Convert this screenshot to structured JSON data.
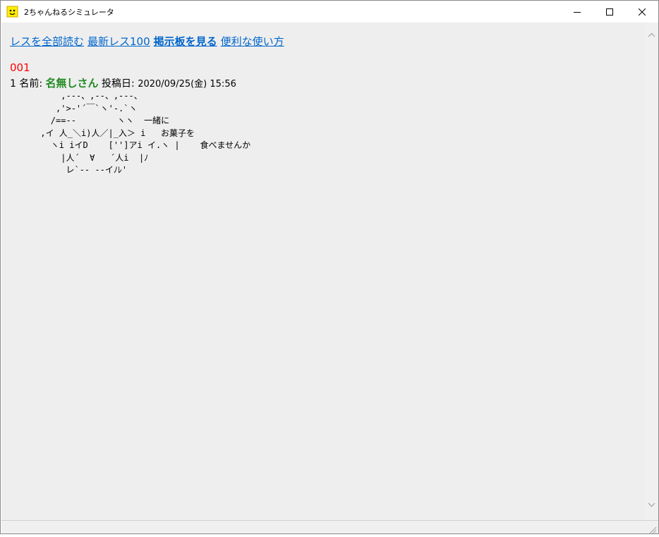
{
  "window": {
    "title": "2ちゃんねるシミュレータ",
    "app_icon": "smiley-face-icon",
    "controls": {
      "minimize": "minimize-icon",
      "maximize": "maximize-icon",
      "close": "close-icon"
    }
  },
  "links": [
    {
      "label": "レスを全部読む",
      "bold": false
    },
    {
      "label": "最新レス100",
      "bold": false
    },
    {
      "label": "掲示板を見る",
      "bold": true
    },
    {
      "label": "便利な使い方",
      "bold": false
    }
  ],
  "post": {
    "res_number": "001",
    "index": "1",
    "name_label": "名前:",
    "name": "名無しさん",
    "date_label": "投稿日:",
    "date": "2020/09/25(金) 15:56",
    "ascii_art": "          ,---、,--、,---、\n         ,'>-'´￣`ヽ'-.`ヽ\n        /==--        ヽヽ  一緒に\n      ,イ 人_＼i)人／|_入＞ i   お菓子を\n        ヽi iイD    ['']アi イ.ヽ |    食べませんか\n          |人´  ∀   ´人i  |ﾉ\n           レ`-- --イﾉﾚ'"
  },
  "colors": {
    "link": "#0066cc",
    "res_number": "#ff0000",
    "name": "#228b22",
    "background": "#eeeeee"
  }
}
